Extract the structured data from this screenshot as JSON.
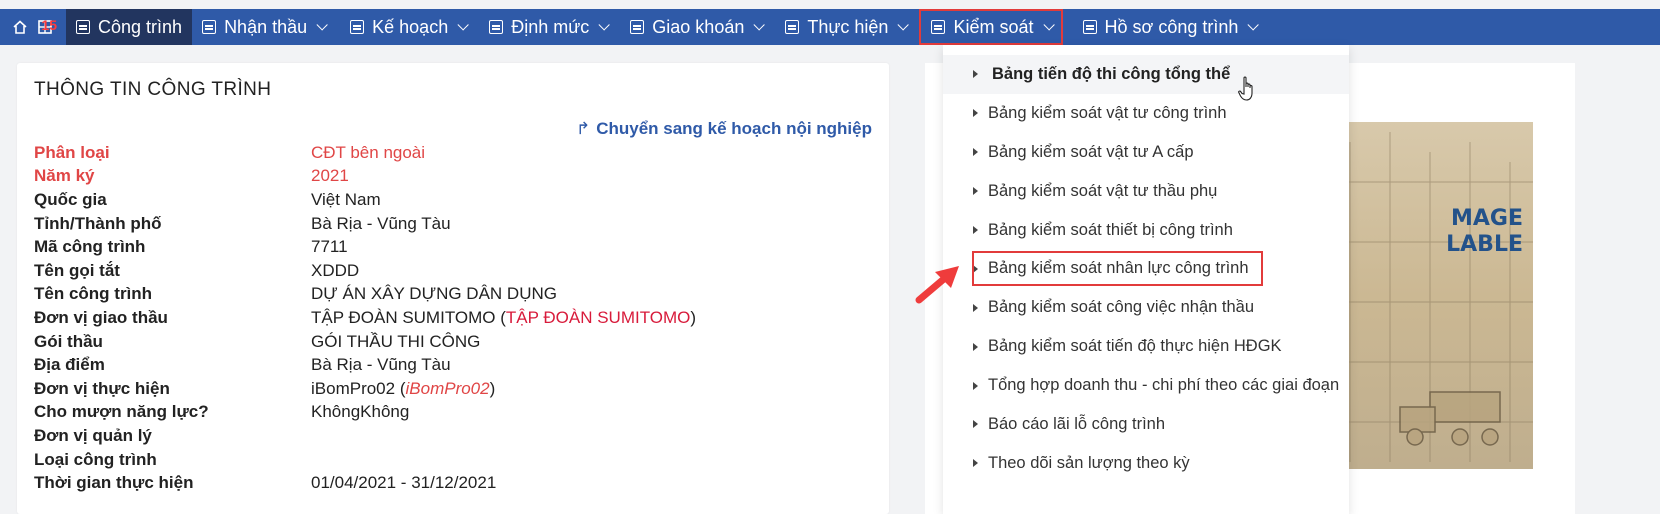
{
  "navbar": {
    "badge": "15",
    "items": [
      {
        "label": "Công trình",
        "has_chevron": false
      },
      {
        "label": "Nhận thầu",
        "has_chevron": true
      },
      {
        "label": "Kế hoạch",
        "has_chevron": true
      },
      {
        "label": "Định mức",
        "has_chevron": true
      },
      {
        "label": "Giao khoán",
        "has_chevron": true
      },
      {
        "label": "Thực hiện",
        "has_chevron": true
      },
      {
        "label": "Kiểm soát",
        "has_chevron": true
      },
      {
        "label": "Hồ sơ công trình",
        "has_chevron": true
      }
    ]
  },
  "info": {
    "title": "THÔNG TIN CÔNG TRÌNH",
    "link": "Chuyển sang kế hoạch nội nghiệp",
    "rows": [
      {
        "label": "Phân loại",
        "value": "CĐT bên ngoài"
      },
      {
        "label": "Năm ký",
        "value": "2021"
      },
      {
        "label": "Quốc gia",
        "value": "Việt Nam"
      },
      {
        "label": "Tỉnh/Thành phố",
        "value": "Bà Rịa - Vũng Tàu"
      },
      {
        "label": "Mã công trình",
        "value": "7711"
      },
      {
        "label": "Tên gọi tắt",
        "value": "XDDD"
      },
      {
        "label": "Tên công trình",
        "value": "DỰ ÁN XÂY DỰNG DÂN DỤNG"
      },
      {
        "label": "Đơn vị giao thầu",
        "value": "TẬP ĐOÀN SUMITOMO",
        "paren": "TẬP ĐOÀN SUMITOMO"
      },
      {
        "label": "Gói thầu",
        "value": "GÓI THẦU THI CÔNG"
      },
      {
        "label": "Địa điểm",
        "value": "Bà Rịa - Vũng Tàu"
      },
      {
        "label": "Đơn vị thực hiện",
        "value": "iBomPro02",
        "paren": "iBomPro02"
      },
      {
        "label": "Cho mượn năng lực?",
        "value": "KhôngKhông"
      },
      {
        "label": "Đơn vị quản lý",
        "value": ""
      },
      {
        "label": "Loại công trình",
        "value": ""
      },
      {
        "label": "Thời gian thực hiện",
        "value": "01/04/2021 - 31/12/2021"
      }
    ]
  },
  "image": {
    "line1": "MAGE",
    "line2": "LABLE"
  },
  "dropdown": {
    "items": [
      "Bảng tiến độ thi công tổng thể",
      "Bảng kiểm soát vật tư công trình",
      "Bảng kiểm soát vật tư A cấp",
      "Bảng kiểm soát vật tư thầu phụ",
      "Bảng kiểm soát thiết bị công trình",
      "Bảng kiểm soát nhân lực công trình",
      "Bảng kiểm soát công việc nhận thầu",
      "Bảng kiểm soát tiến độ thực hiện HĐGK",
      "Tổng hợp doanh thu - chi phí theo các giai đoạn",
      "Báo cáo lãi lỗ công trình",
      "Theo dõi sản lượng theo kỳ"
    ]
  }
}
